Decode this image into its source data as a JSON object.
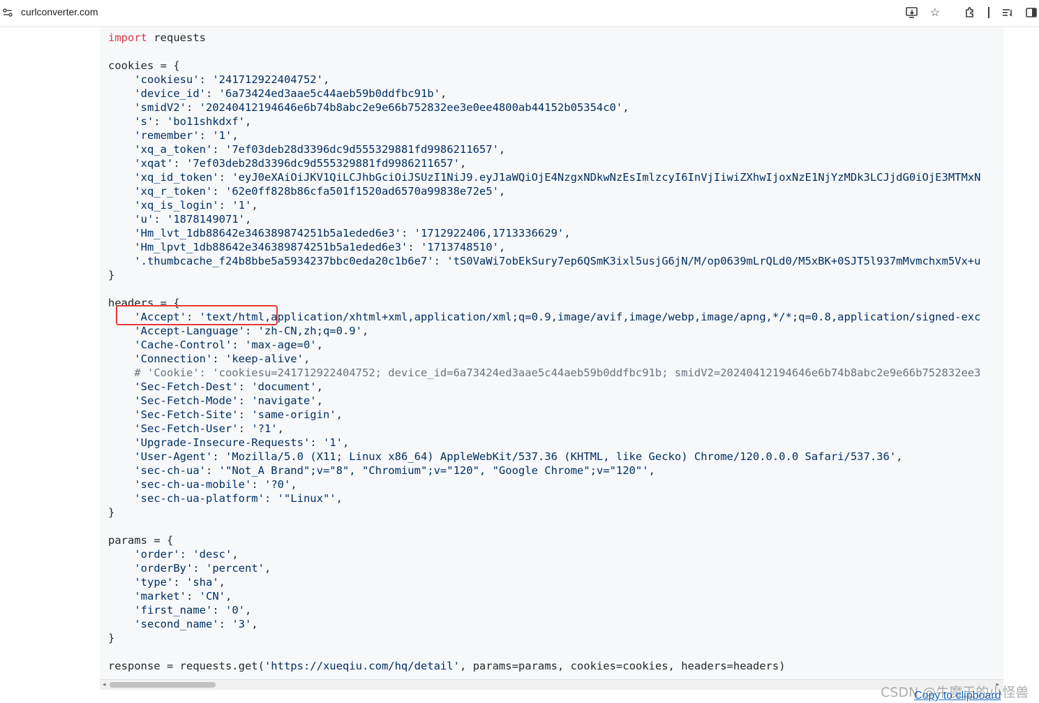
{
  "browser": {
    "url": "curlconverter.com",
    "icons": [
      "site-info-icon",
      "install-app-icon",
      "bookmark-star-icon",
      "extensions-icon",
      "reading-list-icon",
      "side-panel-icon"
    ]
  },
  "code": {
    "lines": [
      [
        {
          "t": "import",
          "c": "kw"
        },
        {
          "t": " requests"
        }
      ],
      [],
      [
        {
          "t": "cookies = {"
        }
      ],
      [
        {
          "t": "    "
        },
        {
          "t": "'cookiesu'",
          "c": "str"
        },
        {
          "t": ": "
        },
        {
          "t": "'241712922404752'",
          "c": "str"
        },
        {
          "t": ","
        }
      ],
      [
        {
          "t": "    "
        },
        {
          "t": "'device_id'",
          "c": "str"
        },
        {
          "t": ": "
        },
        {
          "t": "'6a73424ed3aae5c44aeb59b0ddfbc91b'",
          "c": "str"
        },
        {
          "t": ","
        }
      ],
      [
        {
          "t": "    "
        },
        {
          "t": "'smidV2'",
          "c": "str"
        },
        {
          "t": ": "
        },
        {
          "t": "'20240412194646e6b74b8abc2e9e66b752832ee3e0ee4800ab44152b05354c0'",
          "c": "str"
        },
        {
          "t": ","
        }
      ],
      [
        {
          "t": "    "
        },
        {
          "t": "'s'",
          "c": "str"
        },
        {
          "t": ": "
        },
        {
          "t": "'bo11shkdxf'",
          "c": "str"
        },
        {
          "t": ","
        }
      ],
      [
        {
          "t": "    "
        },
        {
          "t": "'remember'",
          "c": "str"
        },
        {
          "t": ": "
        },
        {
          "t": "'1'",
          "c": "str"
        },
        {
          "t": ","
        }
      ],
      [
        {
          "t": "    "
        },
        {
          "t": "'xq_a_token'",
          "c": "str"
        },
        {
          "t": ": "
        },
        {
          "t": "'7ef03deb28d3396dc9d555329881fd9986211657'",
          "c": "str"
        },
        {
          "t": ","
        }
      ],
      [
        {
          "t": "    "
        },
        {
          "t": "'xqat'",
          "c": "str"
        },
        {
          "t": ": "
        },
        {
          "t": "'7ef03deb28d3396dc9d555329881fd9986211657'",
          "c": "str"
        },
        {
          "t": ","
        }
      ],
      [
        {
          "t": "    "
        },
        {
          "t": "'xq_id_token'",
          "c": "str"
        },
        {
          "t": ": "
        },
        {
          "t": "'eyJ0eXAiOiJKV1QiLCJhbGciOiJSUzI1NiJ9.eyJ1aWQiOjE4NzgxNDkwNzEsImlzcyI6InVjIiwiZXhwIjoxNzE1NjYzMDk3LCJjdG0iOjE3MTMxN",
          "c": "str"
        }
      ],
      [
        {
          "t": "    "
        },
        {
          "t": "'xq_r_token'",
          "c": "str"
        },
        {
          "t": ": "
        },
        {
          "t": "'62e0ff828b86cfa501f1520ad6570a99838e72e5'",
          "c": "str"
        },
        {
          "t": ","
        }
      ],
      [
        {
          "t": "    "
        },
        {
          "t": "'xq_is_login'",
          "c": "str"
        },
        {
          "t": ": "
        },
        {
          "t": "'1'",
          "c": "str"
        },
        {
          "t": ","
        }
      ],
      [
        {
          "t": "    "
        },
        {
          "t": "'u'",
          "c": "str"
        },
        {
          "t": ": "
        },
        {
          "t": "'1878149071'",
          "c": "str"
        },
        {
          "t": ","
        }
      ],
      [
        {
          "t": "    "
        },
        {
          "t": "'Hm_lvt_1db88642e346389874251b5a1eded6e3'",
          "c": "str"
        },
        {
          "t": ": "
        },
        {
          "t": "'1712922406,1713336629'",
          "c": "str"
        },
        {
          "t": ","
        }
      ],
      [
        {
          "t": "    "
        },
        {
          "t": "'Hm_lpvt_1db88642e346389874251b5a1eded6e3'",
          "c": "str"
        },
        {
          "t": ": "
        },
        {
          "t": "'1713748510'",
          "c": "str"
        },
        {
          "t": ","
        }
      ],
      [
        {
          "t": "    "
        },
        {
          "t": "'.thumbcache_f24b8bbe5a5934237bbc0eda20c1b6e7'",
          "c": "str"
        },
        {
          "t": ": "
        },
        {
          "t": "'tS0VaWi7obEkSury7ep6QSmK3ixl5usjG6jN/M/op0639mLrQLd0/M5xBK+0SJT5l937mMvmchxm5Vx+u",
          "c": "str"
        }
      ],
      [
        {
          "t": "}"
        }
      ],
      [],
      [
        {
          "t": "headers = {"
        }
      ],
      [
        {
          "t": "    "
        },
        {
          "t": "'Accept'",
          "c": "str"
        },
        {
          "t": ": "
        },
        {
          "t": "'text/html,application/xhtml+xml,application/xml;q=0.9,image/avif,image/webp,image/apng,*/*;q=0.8,application/signed-exc",
          "c": "str"
        }
      ],
      [
        {
          "t": "    "
        },
        {
          "t": "'Accept-Language'",
          "c": "str"
        },
        {
          "t": ": "
        },
        {
          "t": "'zh-CN,zh;q=0.9'",
          "c": "str"
        },
        {
          "t": ","
        }
      ],
      [
        {
          "t": "    "
        },
        {
          "t": "'Cache-Control'",
          "c": "str"
        },
        {
          "t": ": "
        },
        {
          "t": "'max-age=0'",
          "c": "str"
        },
        {
          "t": ","
        }
      ],
      [
        {
          "t": "    "
        },
        {
          "t": "'Connection'",
          "c": "str"
        },
        {
          "t": ": "
        },
        {
          "t": "'keep-alive'",
          "c": "str"
        },
        {
          "t": ","
        }
      ],
      [
        {
          "t": "    "
        },
        {
          "t": "# 'Cookie': 'cookiesu=241712922404752; device_id=6a73424ed3aae5c44aeb59b0ddfbc91b; smidV2=20240412194646e6b74b8abc2e9e66b752832ee3",
          "c": "cmt"
        }
      ],
      [
        {
          "t": "    "
        },
        {
          "t": "'Sec-Fetch-Dest'",
          "c": "str"
        },
        {
          "t": ": "
        },
        {
          "t": "'document'",
          "c": "str"
        },
        {
          "t": ","
        }
      ],
      [
        {
          "t": "    "
        },
        {
          "t": "'Sec-Fetch-Mode'",
          "c": "str"
        },
        {
          "t": ": "
        },
        {
          "t": "'navigate'",
          "c": "str"
        },
        {
          "t": ","
        }
      ],
      [
        {
          "t": "    "
        },
        {
          "t": "'Sec-Fetch-Site'",
          "c": "str"
        },
        {
          "t": ": "
        },
        {
          "t": "'same-origin'",
          "c": "str"
        },
        {
          "t": ","
        }
      ],
      [
        {
          "t": "    "
        },
        {
          "t": "'Sec-Fetch-User'",
          "c": "str"
        },
        {
          "t": ": "
        },
        {
          "t": "'?1'",
          "c": "str"
        },
        {
          "t": ","
        }
      ],
      [
        {
          "t": "    "
        },
        {
          "t": "'Upgrade-Insecure-Requests'",
          "c": "str"
        },
        {
          "t": ": "
        },
        {
          "t": "'1'",
          "c": "str"
        },
        {
          "t": ","
        }
      ],
      [
        {
          "t": "    "
        },
        {
          "t": "'User-Agent'",
          "c": "str"
        },
        {
          "t": ": "
        },
        {
          "t": "'Mozilla/5.0 (X11; Linux x86_64) AppleWebKit/537.36 (KHTML, like Gecko) Chrome/120.0.0.0 Safari/537.36'",
          "c": "str"
        },
        {
          "t": ","
        }
      ],
      [
        {
          "t": "    "
        },
        {
          "t": "'sec-ch-ua'",
          "c": "str"
        },
        {
          "t": ": "
        },
        {
          "t": "'\"Not_A Brand\";v=\"8\", \"Chromium\";v=\"120\", \"Google Chrome\";v=\"120\"'",
          "c": "str"
        },
        {
          "t": ","
        }
      ],
      [
        {
          "t": "    "
        },
        {
          "t": "'sec-ch-ua-mobile'",
          "c": "str"
        },
        {
          "t": ": "
        },
        {
          "t": "'?0'",
          "c": "str"
        },
        {
          "t": ","
        }
      ],
      [
        {
          "t": "    "
        },
        {
          "t": "'sec-ch-ua-platform'",
          "c": "str"
        },
        {
          "t": ": "
        },
        {
          "t": "'\"Linux\"'",
          "c": "str"
        },
        {
          "t": ","
        }
      ],
      [
        {
          "t": "}"
        }
      ],
      [],
      [
        {
          "t": "params = {"
        }
      ],
      [
        {
          "t": "    "
        },
        {
          "t": "'order'",
          "c": "str"
        },
        {
          "t": ": "
        },
        {
          "t": "'desc'",
          "c": "str"
        },
        {
          "t": ","
        }
      ],
      [
        {
          "t": "    "
        },
        {
          "t": "'orderBy'",
          "c": "str"
        },
        {
          "t": ": "
        },
        {
          "t": "'percent'",
          "c": "str"
        },
        {
          "t": ","
        }
      ],
      [
        {
          "t": "    "
        },
        {
          "t": "'type'",
          "c": "str"
        },
        {
          "t": ": "
        },
        {
          "t": "'sha'",
          "c": "str"
        },
        {
          "t": ","
        }
      ],
      [
        {
          "t": "    "
        },
        {
          "t": "'market'",
          "c": "str"
        },
        {
          "t": ": "
        },
        {
          "t": "'CN'",
          "c": "str"
        },
        {
          "t": ","
        }
      ],
      [
        {
          "t": "    "
        },
        {
          "t": "'first_name'",
          "c": "str"
        },
        {
          "t": ": "
        },
        {
          "t": "'0'",
          "c": "str"
        },
        {
          "t": ","
        }
      ],
      [
        {
          "t": "    "
        },
        {
          "t": "'second_name'",
          "c": "str"
        },
        {
          "t": ": "
        },
        {
          "t": "'3'",
          "c": "str"
        },
        {
          "t": ","
        }
      ],
      [
        {
          "t": "}"
        }
      ],
      [],
      [
        {
          "t": "response = requests.get("
        },
        {
          "t": "'https://xueqiu.com/hq/detail'",
          "c": "str"
        },
        {
          "t": ", params=params, cookies=cookies, headers=headers)"
        }
      ]
    ]
  },
  "copy_label": "Copy to clipboard",
  "watermark": "CSDN @牛魔王的小怪兽",
  "colors": {
    "keyword": "#d73a49",
    "string": "#032f62",
    "comment": "#6a737d",
    "highlight": "#e53935",
    "link": "#1565c0"
  }
}
